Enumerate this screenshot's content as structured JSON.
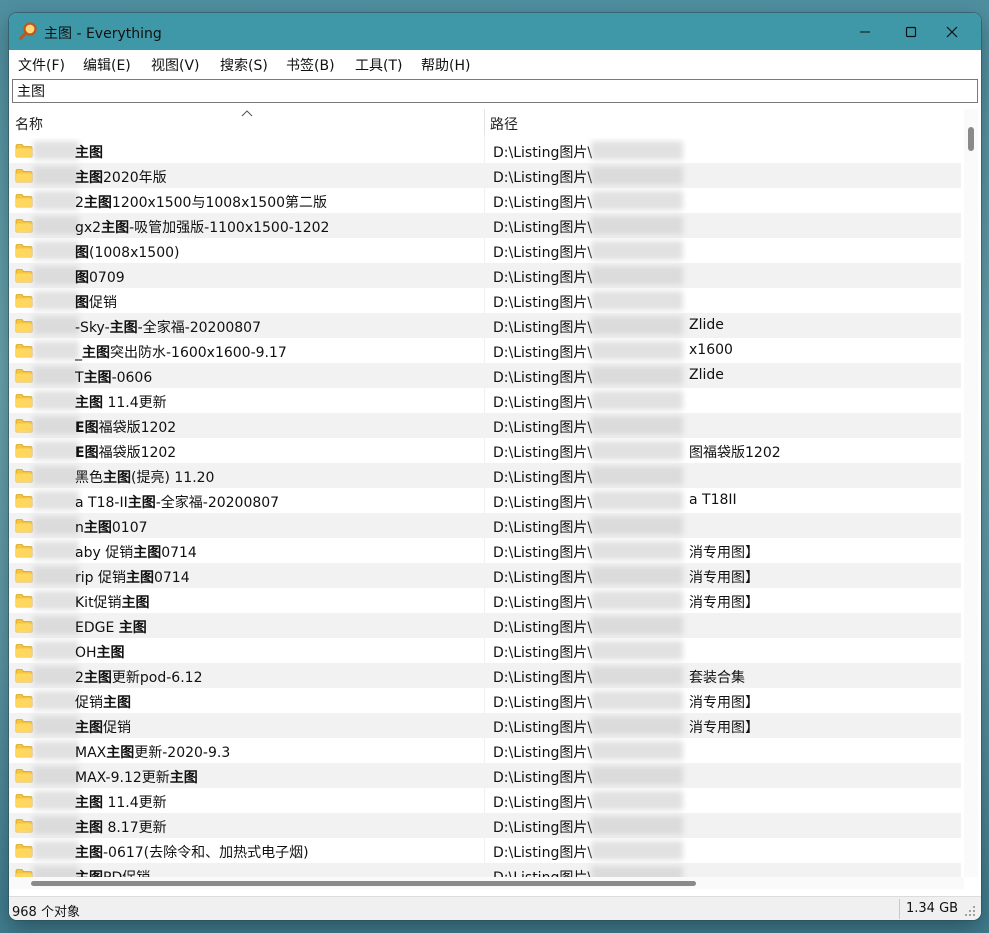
{
  "window": {
    "title": "主图 - Everything",
    "app_icon": "magnifier-icon",
    "controls": [
      "minimize-icon",
      "maximize-icon",
      "close-icon"
    ]
  },
  "menu": {
    "items": [
      "文件(F)",
      "编辑(E)",
      "视图(V)",
      "搜索(S)",
      "书签(B)",
      "工具(T)",
      "帮助(H)"
    ]
  },
  "search": {
    "value": "主图"
  },
  "columns": {
    "name": "名称",
    "path": "路径"
  },
  "rows": [
    {
      "pre": "",
      "bold": "主图",
      "post": "",
      "path": "D:\\Listing图片\\",
      "tail": ""
    },
    {
      "pre": "",
      "bold": "主图",
      "post": "2020年版",
      "path": "D:\\Listing图片\\",
      "tail": ""
    },
    {
      "pre": "2",
      "bold": "主图",
      "post": "1200x1500与1008x1500第二版",
      "path": "D:\\Listing图片\\",
      "tail": ""
    },
    {
      "pre": "gx2",
      "bold": "主图",
      "post": "-吸管加强版-1100x1500-1202",
      "path": "D:\\Listing图片\\",
      "tail": ""
    },
    {
      "pre": "",
      "bold": "图",
      "post": "(1008x1500)",
      "path": "D:\\Listing图片\\",
      "tail": ""
    },
    {
      "pre": "",
      "bold": "图",
      "post": "0709",
      "path": "D:\\Listing图片\\",
      "tail": ""
    },
    {
      "pre": "",
      "bold": "图",
      "post": "促销",
      "path": "D:\\Listing图片\\",
      "tail": ""
    },
    {
      "pre": "-Sky-",
      "bold": "主图",
      "post": "-全家福-20200807",
      "path": "D:\\Listing图片\\",
      "tail": "Zlide"
    },
    {
      "pre": "_",
      "bold": "主图",
      "post": "突出防水-1600x1600-9.17",
      "path": "D:\\Listing图片\\",
      "tail": "x1600"
    },
    {
      "pre": "T",
      "bold": "主图",
      "post": "-0606",
      "path": "D:\\Listing图片\\",
      "tail": "Zlide"
    },
    {
      "pre": "",
      "bold": "主图",
      "post": " 11.4更新",
      "path": "D:\\Listing图片\\",
      "tail": ""
    },
    {
      "pre": "",
      "bold": "E图",
      "post": "福袋版1202",
      "path": "D:\\Listing图片\\",
      "tail": ""
    },
    {
      "pre": "",
      "bold": "E图",
      "post": "福袋版1202",
      "path": "D:\\Listing图片\\",
      "tail": "图福袋版1202"
    },
    {
      "pre": "黑色",
      "bold": "主图",
      "post": "(提亮) 11.20",
      "path": "D:\\Listing图片\\",
      "tail": ""
    },
    {
      "pre": "a T18-II",
      "bold": "主图",
      "post": "-全家福-20200807",
      "path": "D:\\Listing图片\\",
      "tail": "a T18II"
    },
    {
      "pre": "n",
      "bold": "主图",
      "post": "0107",
      "path": "D:\\Listing图片\\",
      "tail": ""
    },
    {
      "pre": "aby 促销",
      "bold": "主图",
      "post": "0714",
      "path": "D:\\Listing图片\\",
      "tail": "消专用图】"
    },
    {
      "pre": "rip 促销",
      "bold": "主图",
      "post": "0714",
      "path": "D:\\Listing图片\\",
      "tail": "消专用图】"
    },
    {
      "pre": "Kit促销",
      "bold": "主图",
      "post": "",
      "path": "D:\\Listing图片\\",
      "tail": "消专用图】"
    },
    {
      "pre": "EDGE ",
      "bold": "主图",
      "post": "",
      "path": "D:\\Listing图片\\",
      "tail": ""
    },
    {
      "pre": "OH",
      "bold": "主图",
      "post": "",
      "path": "D:\\Listing图片\\",
      "tail": ""
    },
    {
      "pre": "2",
      "bold": "主图",
      "post": "更新pod-6.12",
      "path": "D:\\Listing图片\\",
      "tail": "套装合集"
    },
    {
      "pre": "促销",
      "bold": "主图",
      "post": "",
      "path": "D:\\Listing图片\\",
      "tail": "消专用图】"
    },
    {
      "pre": "",
      "bold": "主图",
      "post": "促销",
      "path": "D:\\Listing图片\\",
      "tail": "消专用图】"
    },
    {
      "pre": "MAX",
      "bold": "主图",
      "post": "更新-2020-9.3",
      "path": "D:\\Listing图片\\",
      "tail": ""
    },
    {
      "pre": "MAX-9.12更新",
      "bold": "主图",
      "post": "",
      "path": "D:\\Listing图片\\",
      "tail": ""
    },
    {
      "pre": "",
      "bold": "主图",
      "post": " 11.4更新",
      "path": "D:\\Listing图片\\",
      "tail": ""
    },
    {
      "pre": "",
      "bold": "主图",
      "post": " 8.17更新",
      "path": "D:\\Listing图片\\",
      "tail": ""
    },
    {
      "pre": "",
      "bold": "主图",
      "post": "-0617(去除令和、加热式电子烟)",
      "path": "D:\\Listing图片\\",
      "tail": ""
    },
    {
      "pre": "",
      "bold": "主图",
      "post": "PD促销",
      "path": "D:\\Listing图片\\",
      "tail": ""
    }
  ],
  "status": {
    "count": "968 个对象",
    "size": "1.34 GB"
  },
  "colors": {
    "titlebar": "#3f98a8",
    "row_alt": "#f2f2f2",
    "folder": "#f4c542"
  }
}
